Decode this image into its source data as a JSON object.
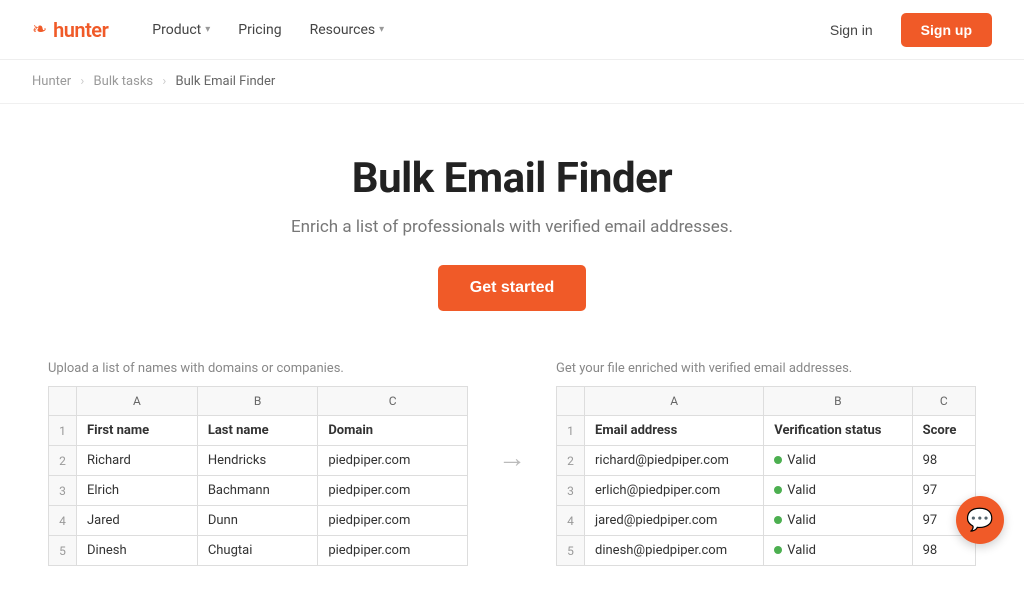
{
  "brand": {
    "logo_icon": "❧",
    "logo_text": "hunter"
  },
  "nav": {
    "product_label": "Product",
    "pricing_label": "Pricing",
    "resources_label": "Resources",
    "signin_label": "Sign in",
    "signup_label": "Sign up"
  },
  "breadcrumb": {
    "root": "Hunter",
    "parent": "Bulk tasks",
    "current": "Bulk Email Finder"
  },
  "hero": {
    "title": "Bulk Email Finder",
    "subtitle": "Enrich a list of professionals with verified email addresses.",
    "cta_label": "Get started"
  },
  "input_table": {
    "label": "Upload a list of names with domains or companies.",
    "col_headers": [
      "",
      "A",
      "B",
      "C"
    ],
    "rows": [
      [
        "1",
        "First name",
        "Last name",
        "Domain"
      ],
      [
        "2",
        "Richard",
        "Hendricks",
        "piedpiper.com"
      ],
      [
        "3",
        "Elrich",
        "Bachmann",
        "piedpiper.com"
      ],
      [
        "4",
        "Jared",
        "Dunn",
        "piedpiper.com"
      ],
      [
        "5",
        "Dinesh",
        "Chugtai",
        "piedpiper.com"
      ]
    ]
  },
  "output_table": {
    "label": "Get your file enriched with verified email addresses.",
    "col_headers": [
      "",
      "A",
      "B",
      "C"
    ],
    "rows": [
      [
        "1",
        "Email address",
        "Verification status",
        "Score"
      ],
      [
        "2",
        "richard@piedpiper.com",
        "Valid",
        "98"
      ],
      [
        "3",
        "erlich@piedpiper.com",
        "Valid",
        "97"
      ],
      [
        "4",
        "jared@piedpiper.com",
        "Valid",
        "97"
      ],
      [
        "5",
        "dinesh@piedpiper.com",
        "Valid",
        "98"
      ]
    ]
  }
}
